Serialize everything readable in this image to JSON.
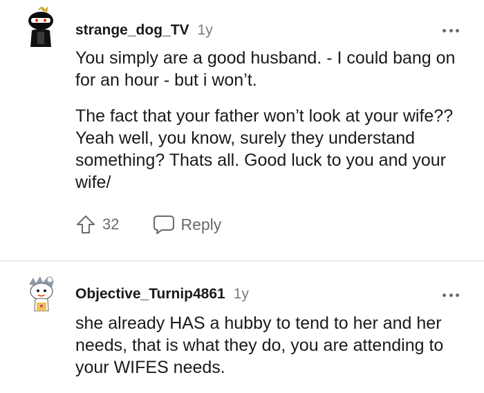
{
  "comments": [
    {
      "username": "strange_dog_TV",
      "age": "1y",
      "paragraphs": [
        "You simply are a good husband. - I could bang on for an hour - but i won’t.",
        "The fact that your father won’t look at your wife?? Yeah well, you know, surely they understand something? Thats all. Good luck to you and your wife/"
      ],
      "upvotes": "32",
      "reply_label": "Reply",
      "avatar_icon": "snoo-avatar-icon"
    },
    {
      "username": "Objective_Turnip4861",
      "age": "1y",
      "paragraphs": [
        "she already HAS a hubby to tend to her and her needs, that is what they do, you are attending to your WIFES needs."
      ],
      "avatar_icon": "snoo-avatar-icon"
    }
  ],
  "colors": {
    "text": "#1a1a1b",
    "muted": "#7c7c7c",
    "divider": "#ebebeb"
  }
}
